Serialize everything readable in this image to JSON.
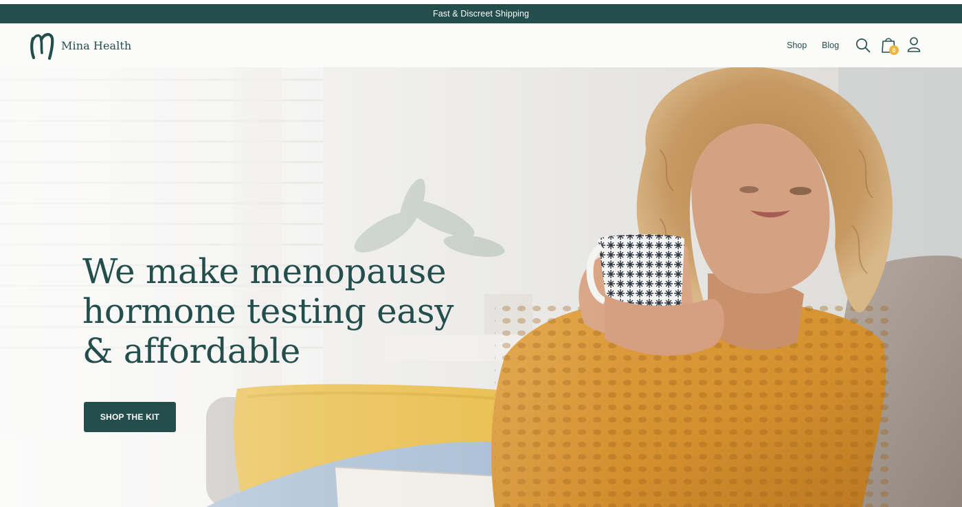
{
  "announcement": {
    "text": "Fast & Discreet Shipping"
  },
  "header": {
    "brand_name": "Mina Health",
    "nav": {
      "shop_label": "Shop",
      "blog_label": "Blog"
    },
    "cart_count": "0",
    "icons": [
      "brand-logo-mark",
      "search-icon",
      "cart-icon",
      "account-icon"
    ]
  },
  "hero": {
    "title": "We make menopause hormone testing easy & affordable",
    "cta_label": "SHOP THE KIT"
  },
  "colors": {
    "brand_green": "#234e4c",
    "badge_yellow": "#f0b53a",
    "header_bg": "#fbfbfa"
  }
}
